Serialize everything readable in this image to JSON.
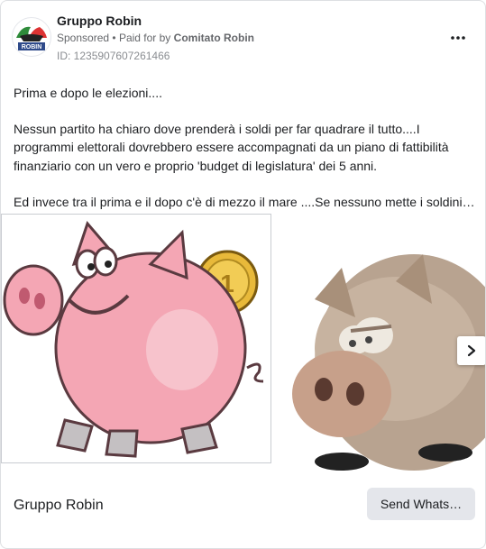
{
  "header": {
    "page_name": "Gruppo Robin",
    "sponsored": "Sponsored",
    "separator": "•",
    "paid_for_by_prefix": "Paid for by",
    "paid_for_by_name": "Comitato Robin",
    "ad_id": "ID: 1235907607261466",
    "avatar_text": "ROBIN",
    "more_icon": "more-dots-icon"
  },
  "body": {
    "line1": "Prima e dopo le elezioni....",
    "line2": "Nessun partito ha chiaro dove prenderà i soldi per far quadrare il tutto....I",
    "line3": "programmi elettorali dovrebbero essere accompagnati da un piano di fattibilità",
    "line4": "finanziario con un vero e proprio 'budget di legislatura' dei 5 anni.",
    "line5": "Ed invece tra il prima e il dopo c'è di mezzo il mare ....Se nessuno mette i soldini…"
  },
  "carousel": {
    "image1": "piggy-bank-cartoon",
    "image2": "sad-pig-figurine",
    "next_icon": "chevron-right-icon"
  },
  "footer": {
    "page_name": "Gruppo Robin",
    "cta_label": "Send Whats…"
  },
  "colors": {
    "text": "#1c1e21",
    "secondary": "#65676b",
    "button_bg": "#e4e6eb",
    "pig_pink": "#f4a6b4"
  }
}
